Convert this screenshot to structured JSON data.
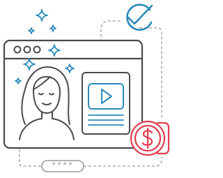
{
  "rating": {
    "text": "****"
  },
  "icons": {
    "window_dots": 3,
    "verified": "check-badge-icon",
    "play": "play-icon",
    "dollar": "dollar-coin-icon",
    "sparkles": "sparkle-icon",
    "avatar": "woman-avatar-icon"
  },
  "colors": {
    "stroke": "#4a4a4a",
    "accent_blue": "#2b8ab8",
    "accent_red": "#e03c4f",
    "dashed": "#9a9a9a",
    "pill_border": "#9a9a9a"
  }
}
